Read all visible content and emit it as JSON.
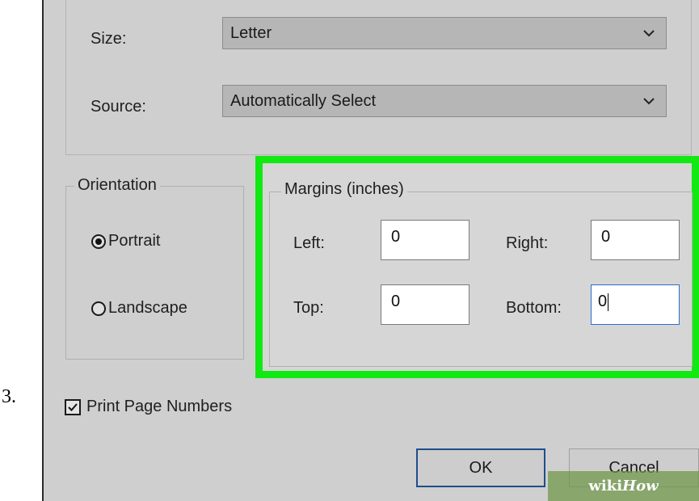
{
  "step_number": "3.",
  "paper": {
    "size_label": "Size:",
    "size_value": "Letter",
    "source_label": "Source:",
    "source_value": "Automatically Select"
  },
  "orientation": {
    "title": "Orientation",
    "portrait_label": "Portrait",
    "landscape_label": "Landscape",
    "selected": "Portrait"
  },
  "margins": {
    "title": "Margins (inches)",
    "left_label": "Left:",
    "left_value": "0",
    "right_label": "Right:",
    "right_value": "0",
    "top_label": "Top:",
    "top_value": "0",
    "bottom_label": "Bottom:",
    "bottom_value": "0",
    "highlight_color": "#12e812"
  },
  "print_page_numbers": {
    "label": "Print Page Numbers",
    "checked": true
  },
  "buttons": {
    "ok": "OK",
    "cancel": "Cancel"
  },
  "watermark": {
    "wiki": "wiki",
    "how": "How"
  },
  "icons": {
    "dropdown": "chevron-down-icon",
    "checkbox_mark": "checkmark-icon"
  }
}
